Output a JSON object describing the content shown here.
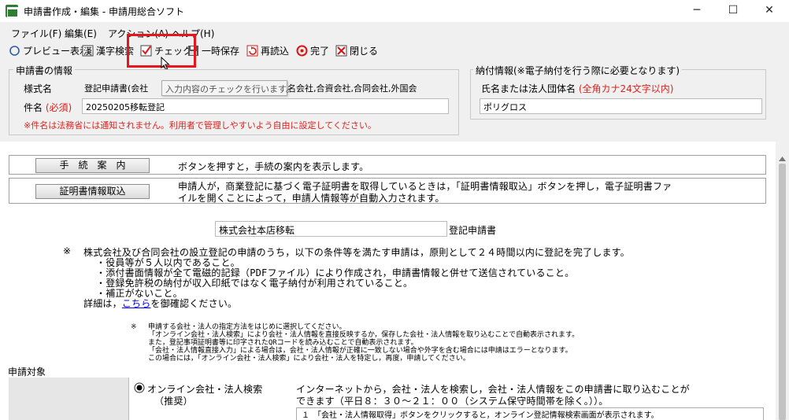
{
  "window": {
    "title": "申請書作成・編集 - 申請用総合ソフト",
    "minimize": "─",
    "maximize": "☐",
    "close": "✕"
  },
  "menu": [
    "ファイル(F)",
    "編集(E)",
    "アクション(A)",
    "ヘルプ(H)"
  ],
  "toolbar": {
    "preview": "プレビュー表示",
    "kanji": "漢字検索",
    "check": "チェック",
    "save": "一時保存",
    "reload": "再読込",
    "complete": "完了",
    "close": "閉じる"
  },
  "tooltip": "入力内容のチェックを行います。",
  "application_info": {
    "group_title": "申請書の情報",
    "form_name_label": "様式名",
    "form_name_value_left": "登記申請書(会社",
    "form_name_value_right": "名会社,合資会社,合同会社,外国会",
    "subject_label": "件名",
    "subject_required": "(必須)",
    "subject_value": "20250205移転登記",
    "note": "※件名は法務省には通知されません。利用者で管理しやすいよう自由に設定してください。"
  },
  "payment_info": {
    "group_title": "納付情報(※電子納付を行う際に必要となります)",
    "name_label": "氏名または法人団体名",
    "name_hint": "(全角カナ24文字以内)",
    "name_value": "ポリグロス"
  },
  "content": {
    "guide_button": "手　続　案　内",
    "guide_text": "ボタンを押すと，手続の案内を表示します。",
    "cert_button": "証明書情報取込",
    "cert_text_1": "申請人が，商業登記に基づく電子証明書を取得しているときは，「証明書情報取込」ボタンを押し，電子証明書ファ",
    "cert_text_2": "イルを開くことによって，申請人情報等が自動入力されます。",
    "registration_type": "株式会社本店移転",
    "registration_suffix": "登記申請書",
    "notice_mark": "※",
    "notice_1": "株式会社及び合同会社の設立登記の申請のうち，以下の条件等を満たす申請は，原則として２４時間以内に登記を完了します。",
    "notice_2": "・役員等が５人以内であること。",
    "notice_3": "・添付書面情報が全て電磁的記録（PDFファイル）により作成され，申請書情報と併せて送信されていること。",
    "notice_4": "・登録免許税の納付が収入印紙ではなく電子納付が利用されていること。",
    "notice_5": "・補正がないこと。",
    "detail_prefix": "詳細は，",
    "detail_link": "こちら",
    "detail_suffix": "を御確認ください。",
    "small_mark": "※",
    "small_1": "申請する会社・法人の指定方法をはじめに選択してください。",
    "small_2": "「オンライン会社・法人検索」により会社・法人情報を直接反映するか，保存した会社・法人情報を取り込むことで自動表示されます。",
    "small_3": "また，登記事項証明書等に印字されたQRコードを読み込むことで自動表示されます。",
    "small_4": "「会社・法人情報直接入力」による場合は，会社・法人情報が正確に一致しない場合や外字を含む場合には申請はエラーとなります。",
    "small_5": "この場合には，「オンライン会社・法人検索」により会社・法人を特定し，再度，申請してください。",
    "target_label": "申請対象",
    "radio_label": "オンライン会社・法人検索",
    "radio_sub": "（推奨）",
    "radio_desc_1": "インターネットから，会社・法人を検索し，会社・法人情報をこの申請書に取り込むことが",
    "radio_desc_2": "できます（平日８：３０～２１：００（システム保守時間帯を除く。））。",
    "step_1": "１　「会社・法人情報取得」ボタンをクリックすると，オンライン登記情報検索画面が表示されます。"
  },
  "colors": {
    "highlight": "#e5161d",
    "required": "#e0201b"
  }
}
